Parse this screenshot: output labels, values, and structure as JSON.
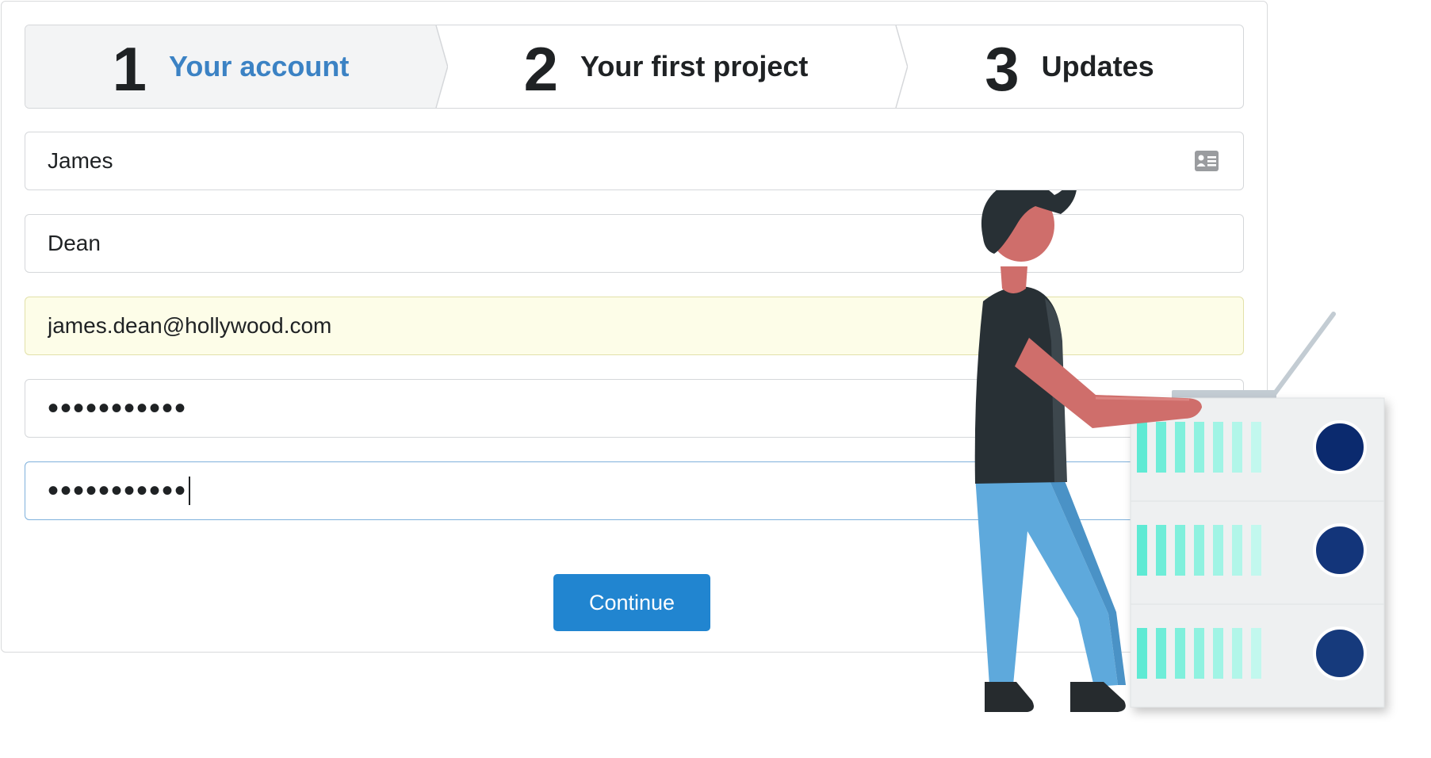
{
  "steps": [
    {
      "number": "1",
      "label": "Your account",
      "active": true
    },
    {
      "number": "2",
      "label": "Your first project",
      "active": false
    },
    {
      "number": "3",
      "label": "Updates",
      "active": false
    }
  ],
  "form": {
    "first_name": "James",
    "last_name": "Dean",
    "email": "james.dean@hollywood.com",
    "password": "•••••••••••",
    "password_confirm": "•••••••••••"
  },
  "continue_label": "Continue",
  "icons": {
    "contact_card": "contact-card-icon"
  },
  "colors": {
    "accent": "#2185d0",
    "active_step_label": "#3b82c4",
    "autofill_bg": "#fdfde8",
    "server_light": "#5eead4",
    "server_dot": "#0b2a6e",
    "person_shirt": "#283035",
    "person_pants": "#5ea9dc",
    "person_skin": "#cf6e6b"
  }
}
